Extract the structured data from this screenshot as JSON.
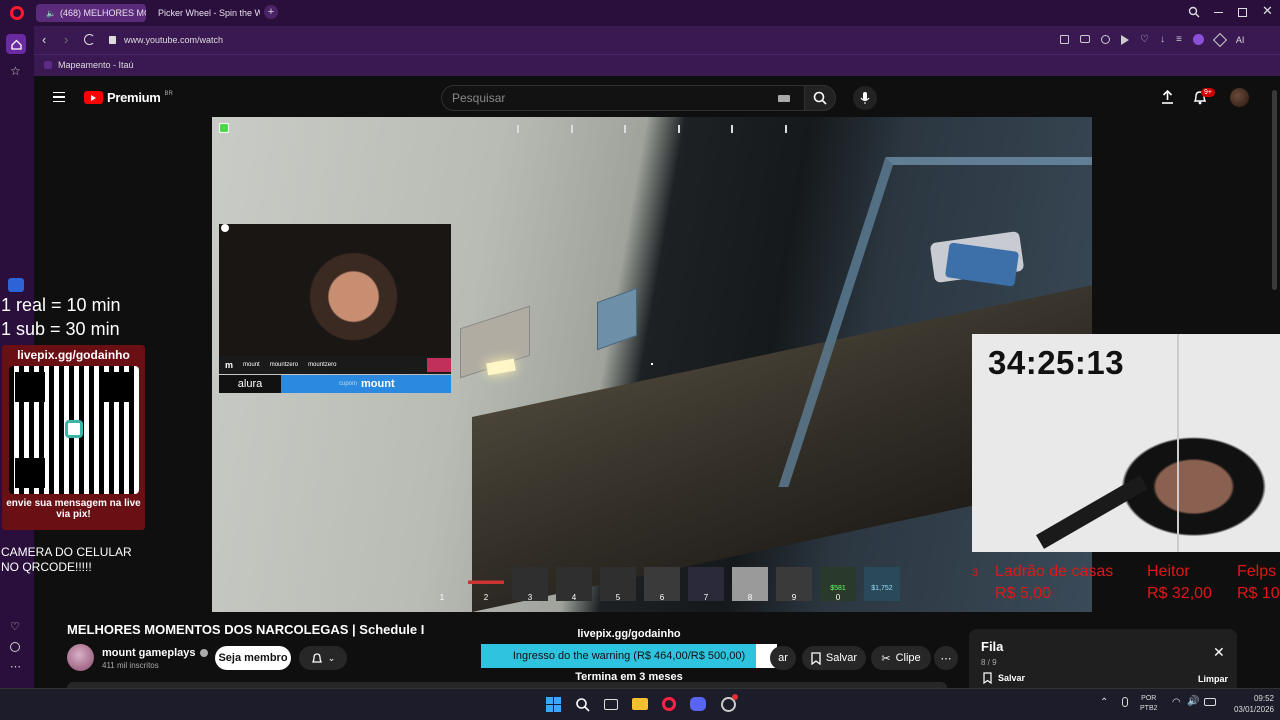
{
  "browser": {
    "tabs": [
      {
        "label": "(468) MELHORES MO",
        "active": true
      },
      {
        "label": "Picker Wheel - Spin the W",
        "active": false
      }
    ],
    "url": "www.youtube.com/watch",
    "bookmark": "Mapeamento - Itaú",
    "ai_label": "AI"
  },
  "youtube": {
    "logo_text": "Premium",
    "region": "BR",
    "search_placeholder": "Pesquisar",
    "notification_badge": "9+"
  },
  "stream": {
    "info_line1": "1 real = 10 min",
    "info_line2": "1 sub = 30 min",
    "qr_url": "livepix.gg/godainho",
    "qr_caption": "envie sua mensagem na live via pix!",
    "camera_note": "CAMERA DO CELULAR NO QRCODE!!!!!",
    "timer": "34:25:13",
    "social": [
      "mount",
      "mountzero",
      "mountzero"
    ],
    "sponsor": "alura",
    "sponsor_sub": "cupom",
    "sponsor_name": "mount",
    "hotbar": [
      "1",
      "2",
      "3",
      "4",
      "5",
      "6",
      "7",
      "8",
      "9",
      "0"
    ],
    "hotbar_money": [
      "$581",
      "$1,752"
    ],
    "leaderboard": [
      {
        "rank": "3",
        "name": "Ladrão de casas",
        "amount": "R$ 5,00"
      },
      {
        "rank": "",
        "name": "Heitor",
        "amount": "R$ 32,00"
      },
      {
        "rank": "",
        "name": "Felps",
        "amount": "R$ 10"
      }
    ],
    "goal_header": "livepix.gg/godainho",
    "goal_text": "Ingresso do the warning (R$ 464,00/R$ 500,00)",
    "goal_progress": 0.928,
    "goal_footer": "Termina em 3 meses"
  },
  "video": {
    "title": "MELHORES MOMENTOS DOS NARCOLEGAS | Schedule I",
    "channel": "mount gameplays",
    "subscribers": "411 mil inscritos",
    "join_label": "Seja membro",
    "save_label": "Salvar",
    "clip_label": "Clipe",
    "hidden_label": "ar"
  },
  "queue": {
    "title": "Fila",
    "count": "8 / 9",
    "save_label": "Salvar",
    "clear_label": "Limpar"
  },
  "taskbar": {
    "lang1": "POR",
    "lang2": "PTB2",
    "time": "09:52",
    "date": "03/01/2026"
  },
  "colors": {
    "opera_purple": "#2a0f3d",
    "youtube_red": "#ff0000",
    "goal_bar": "#2ec4e0",
    "leaderboard_red": "#e01818"
  }
}
